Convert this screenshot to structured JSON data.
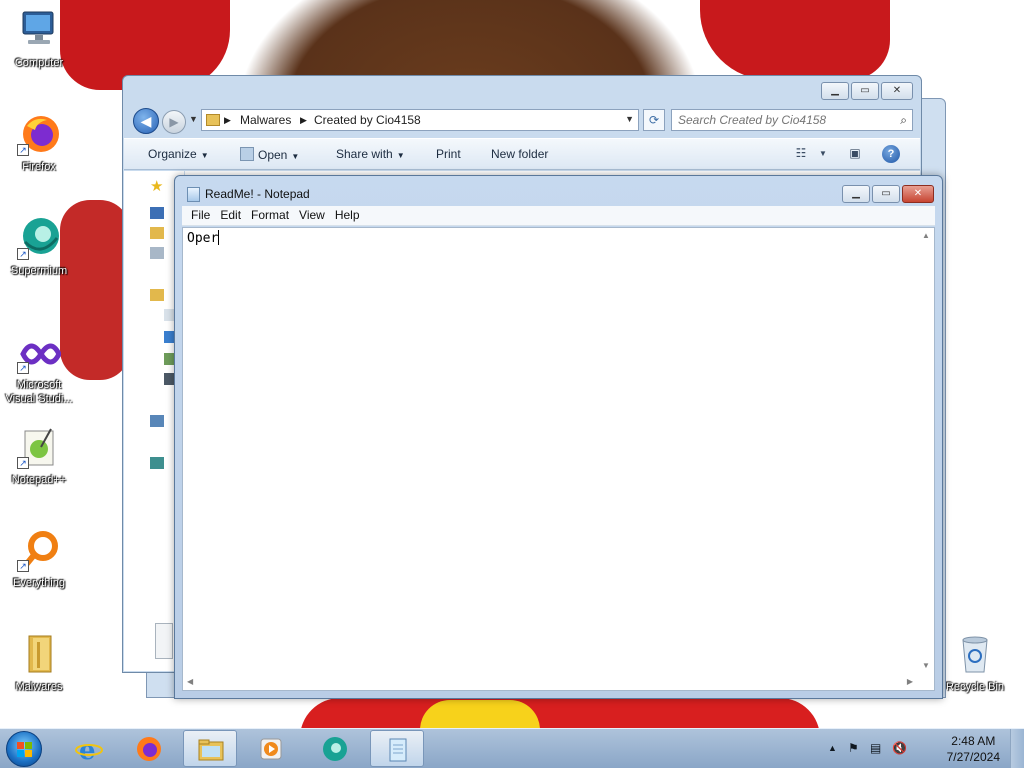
{
  "desktop": {
    "icons": [
      {
        "label": "Computer"
      },
      {
        "label": "Firefox"
      },
      {
        "label": "Supermium"
      },
      {
        "label": "Microsoft Visual Studi..."
      },
      {
        "label": "Notepad++"
      },
      {
        "label": "Everything"
      },
      {
        "label": "Malwares"
      },
      {
        "label": "Recycle Bin"
      }
    ]
  },
  "explorer": {
    "breadcrumb": [
      "Malwares",
      "Created by Cio4158"
    ],
    "search_placeholder": "Search Created by Cio4158",
    "commands": {
      "organize": "Organize",
      "open": "Open",
      "share_with": "Share with",
      "print": "Print",
      "new_folder": "New folder"
    },
    "help_label": "?"
  },
  "notepad": {
    "title": "ReadMe! - Notepad",
    "menu": [
      "File",
      "Edit",
      "Format",
      "View",
      "Help"
    ],
    "content": "Oper"
  },
  "taskbar": {
    "time": "2:48 AM",
    "date": "7/27/2024"
  },
  "colors": {
    "taskbar": "#9db6d4",
    "titlebar": "#c6d9ef",
    "close_red": "#c74532"
  }
}
